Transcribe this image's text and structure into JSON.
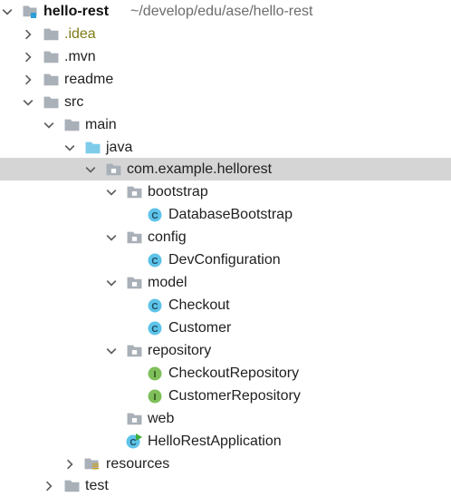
{
  "project": {
    "name": "hello-rest",
    "path": "~/develop/edu/ase/hello-rest"
  },
  "nodes": {
    "idea": ".idea",
    "mvn": ".mvn",
    "readme": "readme",
    "src": "src",
    "main": "main",
    "java": "java",
    "package": "com.example.hellorest",
    "bootstrap": "bootstrap",
    "database_bootstrap": "DatabaseBootstrap",
    "config": "config",
    "dev_configuration": "DevConfiguration",
    "model": "model",
    "checkout": "Checkout",
    "customer": "Customer",
    "repository": "repository",
    "checkout_repository": "CheckoutRepository",
    "customer_repository": "CustomerRepository",
    "web": "web",
    "hello_rest_application": "HelloRestApplication",
    "resources": "resources",
    "test": "test"
  },
  "badges": {
    "class": "C",
    "interface": "I"
  },
  "colors": {
    "folder": "#a9b0b8",
    "source_folder": "#7fcbea",
    "class_badge": "#5ec3e9",
    "interface_badge": "#7fbf5a",
    "selection": "#d5d5d5",
    "idea_text": "#7f7a16",
    "project_accent": "#2b9fd6"
  }
}
